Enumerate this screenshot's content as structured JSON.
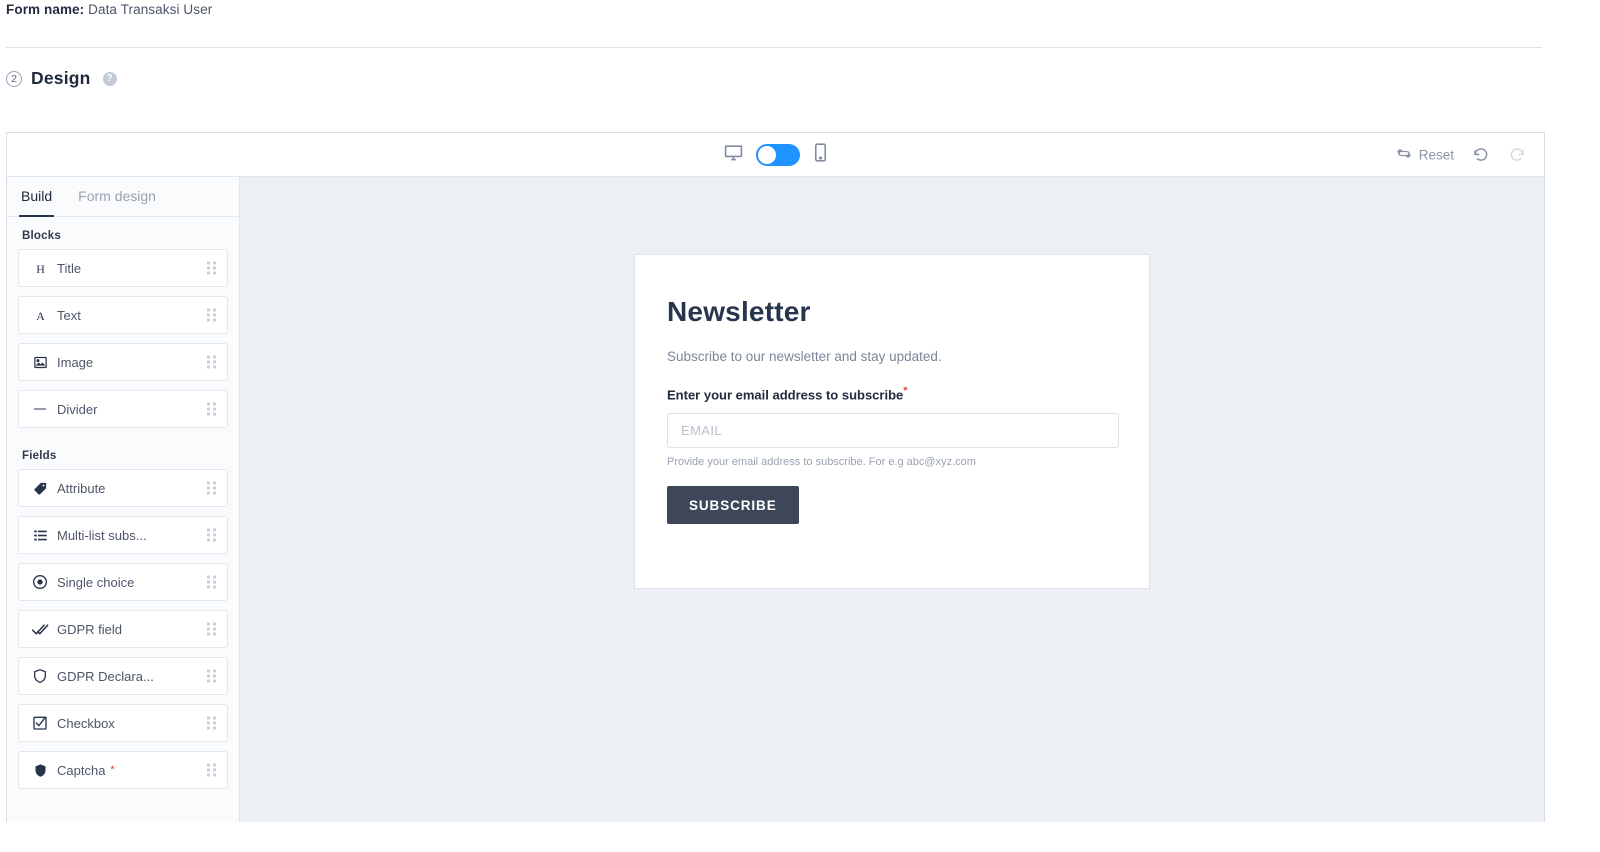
{
  "header": {
    "form_name_label": "Form name:",
    "form_name_value": "Data Transaksi User",
    "step_number": "2",
    "step_title": "Design",
    "help_icon": "question-mark-icon"
  },
  "toolbar": {
    "desktop_icon": "desktop-monitor-icon",
    "mobile_icon": "mobile-phone-icon",
    "device_toggle_state": "desktop",
    "reset_label": "Reset",
    "reset_icon": "refresh-arrows-icon",
    "undo_icon": "undo-arrow-icon",
    "redo_icon": "redo-arrow-icon",
    "redo_disabled": true,
    "accent_color": "#1f93ff"
  },
  "sidebar": {
    "tabs": [
      {
        "label": "Build",
        "active": true
      },
      {
        "label": "Form design",
        "active": false
      }
    ],
    "groups": [
      {
        "title": "Blocks",
        "items": [
          {
            "label": "Title",
            "icon": "heading-h-icon",
            "required": false
          },
          {
            "label": "Text",
            "icon": "text-a-icon",
            "required": false
          },
          {
            "label": "Image",
            "icon": "image-picture-icon",
            "required": false
          },
          {
            "label": "Divider",
            "icon": "divider-line-icon",
            "required": false
          }
        ]
      },
      {
        "title": "Fields",
        "items": [
          {
            "label": "Attribute",
            "icon": "tag-label-icon",
            "required": false
          },
          {
            "label": "Multi-list subs...",
            "icon": "list-lines-icon",
            "required": false
          },
          {
            "label": "Single choice",
            "icon": "radio-button-icon",
            "required": false
          },
          {
            "label": "GDPR field",
            "icon": "double-check-icon",
            "required": false
          },
          {
            "label": "GDPR Declara...",
            "icon": "shield-outline-icon",
            "required": false
          },
          {
            "label": "Checkbox",
            "icon": "checkbox-checked-icon",
            "required": false
          },
          {
            "label": "Captcha",
            "icon": "shield-filled-icon",
            "required": true,
            "required_mark": "*"
          }
        ]
      }
    ],
    "drag_handle_icon": "drag-grip-dots-icon"
  },
  "preview": {
    "title": "Newsletter",
    "subtitle": "Subscribe to our newsletter and stay updated.",
    "email_label": "Enter your email address to subscribe",
    "email_required_mark": "*",
    "email_value": "",
    "email_placeholder": "EMAIL",
    "helper_text": "Provide your email address to subscribe. For e.g abc@xyz.com",
    "submit_label": "SUBSCRIBE",
    "submit_color": "#3d4759",
    "canvas_color": "#eceff4"
  }
}
